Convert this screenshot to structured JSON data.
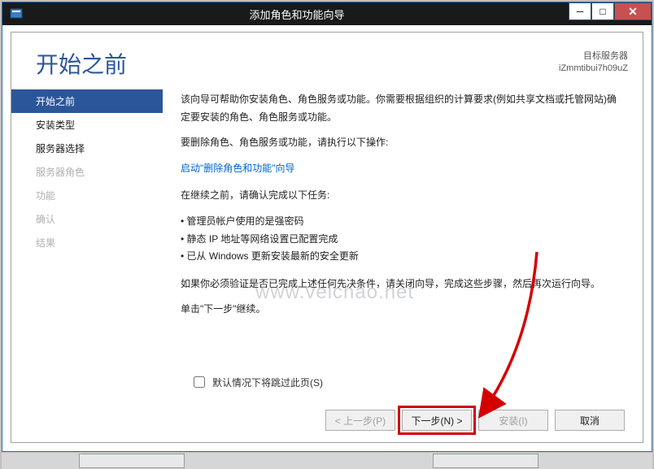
{
  "window": {
    "title": "添加角色和功能向导"
  },
  "header": {
    "title": "开始之前",
    "target_label": "目标服务器",
    "target_server": "iZmmtibui7h09uZ"
  },
  "nav": {
    "items": [
      {
        "label": "开始之前",
        "active": true
      },
      {
        "label": "安装类型"
      },
      {
        "label": "服务器选择"
      },
      {
        "label": "服务器角色",
        "disabled": true
      },
      {
        "label": "功能",
        "disabled": true
      },
      {
        "label": "确认",
        "disabled": true
      },
      {
        "label": "结果",
        "disabled": true
      }
    ]
  },
  "content": {
    "intro": "该向导可帮助你安装角色、角色服务或功能。你需要根据组织的计算要求(例如共享文档或托管网站)确定要安装的角色、角色服务或功能。",
    "remove_prompt": "要删除角色、角色服务或功能，请执行以下操作:",
    "remove_link": "启动\"删除角色和功能\"向导",
    "tasks_intro": "在继续之前，请确认完成以下任务:",
    "tasks": [
      "管理员帐户使用的是强密码",
      "静态 IP 地址等网络设置已配置完成",
      "已从 Windows 更新安装最新的安全更新"
    ],
    "verify_note": "如果你必须验证是否已完成上述任何先决条件，请关闭向导，完成这些步骤，然后再次运行向导。",
    "continue_note": "单击\"下一步\"继续。"
  },
  "footer": {
    "skip_label": "默认情况下将跳过此页(S)",
    "buttons": {
      "prev": "< 上一步(P)",
      "next": "下一步(N) >",
      "install": "安装(I)",
      "cancel": "取消"
    }
  },
  "watermark": "www.veichao.net"
}
